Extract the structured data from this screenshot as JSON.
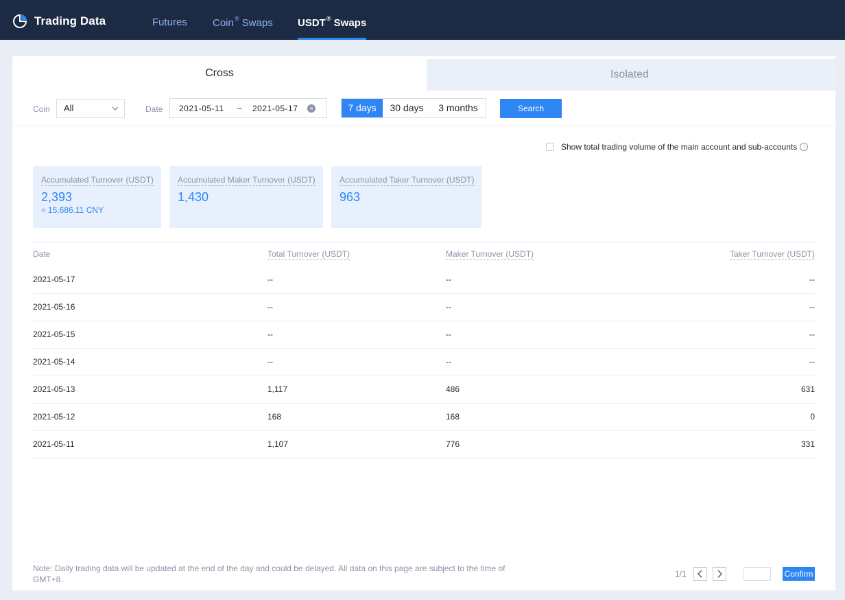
{
  "header": {
    "brand_title": "Trading Data",
    "nav": {
      "futures": "Futures",
      "coin_swaps_prefix": "Coin",
      "usdt_swaps_prefix": "USDT",
      "reg_mark": "®",
      "swaps_suffix": "Swaps"
    }
  },
  "tabs": {
    "cross": "Cross",
    "isolated": "Isolated"
  },
  "filters": {
    "coin_label": "Coin",
    "coin_value": "All",
    "date_label": "Date",
    "date_start": "2021-05-11",
    "date_separator": "–",
    "date_end": "2021-05-17",
    "periods": [
      "7 days",
      "30 days",
      "3 months"
    ],
    "active_period": "7 days",
    "search_label": "Search"
  },
  "options": {
    "show_total_label": "Show total trading volume of the main account and sub-accounts",
    "show_total_checked": false
  },
  "stats": [
    {
      "label": "Accumulated Turnover (USDT)",
      "value": "2,393",
      "sub": "≈ 15,686.11 CNY"
    },
    {
      "label": "Accumulated Maker Turnover (USDT)",
      "value": "1,430"
    },
    {
      "label": "Accumulated Taker Turnover (USDT)",
      "value": "963"
    }
  ],
  "table": {
    "headers": [
      "Date",
      "Total Turnover (USDT)",
      "Maker Turnover (USDT)",
      "Taker Turnover (USDT)"
    ],
    "rows": [
      [
        "2021-05-17",
        "--",
        "--",
        "--"
      ],
      [
        "2021-05-16",
        "--",
        "--",
        "--"
      ],
      [
        "2021-05-15",
        "--",
        "--",
        "--"
      ],
      [
        "2021-05-14",
        "--",
        "--",
        "--"
      ],
      [
        "2021-05-13",
        "1,117",
        "486",
        "631"
      ],
      [
        "2021-05-12",
        "168",
        "168",
        "0"
      ],
      [
        "2021-05-11",
        "1,107",
        "776",
        "331"
      ]
    ]
  },
  "footer": {
    "note": "Note: Daily trading data will be updated at the end of the day and could be delayed. All data on this page are subject to the time of GMT+8.",
    "page_indicator": "1/1",
    "confirm_label": "Confirm"
  },
  "colors": {
    "nav_bg": "#1c2a44",
    "accent": "#2e86f5",
    "stat_bg": "#e8f0fd"
  }
}
